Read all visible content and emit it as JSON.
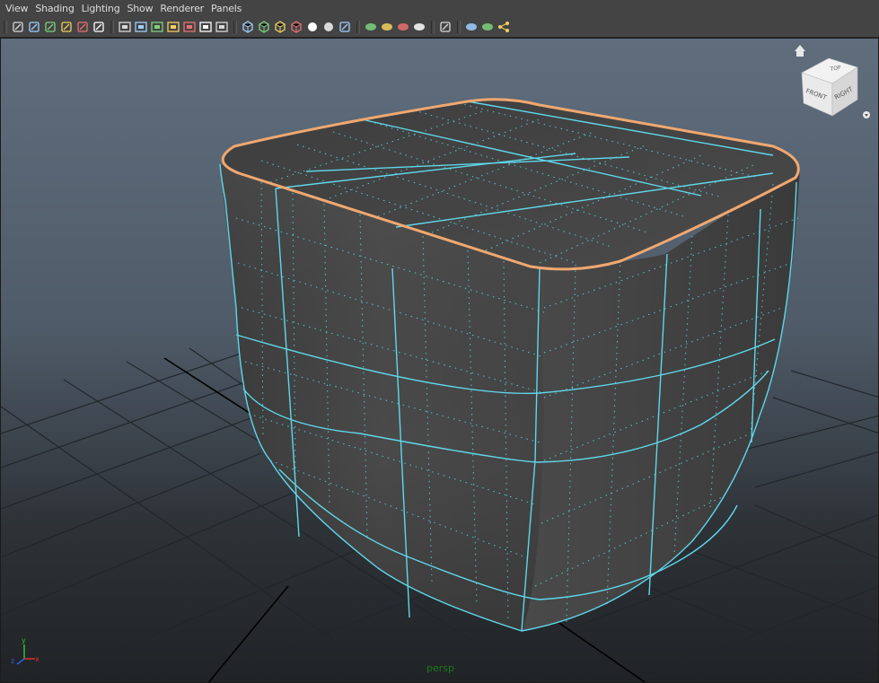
{
  "menu": {
    "items": [
      "View",
      "Shading",
      "Lighting",
      "Show",
      "Renderer",
      "Panels"
    ]
  },
  "toolbar": {
    "groups": [
      [
        "select-camera-icon",
        "camera-attributes-icon",
        "bookmarks-icon",
        "image-plane-icon",
        "2d-pan-zoom-icon",
        "grease-pencil-icon"
      ],
      [
        "grid-icon",
        "film-gate-icon",
        "resolution-gate-icon",
        "gate-mask-icon",
        "field-chart-icon",
        "safe-action-icon",
        "safe-title-icon"
      ],
      [
        "wireframe-icon",
        "smooth-shade-icon",
        "wireframe-on-shaded-icon",
        "textured-icon",
        "use-all-lights-icon",
        "shadows-icon",
        "screen-space-ao-icon"
      ],
      [
        "motion-blur-icon",
        "multisample-aa-icon",
        "depth-of-field-icon",
        "xray-icon"
      ],
      [
        "isolate-select-icon"
      ],
      [
        "xray-joints-icon",
        "xray-active-icon",
        "share-icon"
      ]
    ]
  },
  "viewport": {
    "camera_label": "persp",
    "viewcube": {
      "top_label": "TOP",
      "front_label": "FRONT",
      "right_label": "RIGHT"
    },
    "axis": {
      "y_label": "y",
      "x_label": "x",
      "z_label": "z",
      "x_color": "#d83030",
      "y_color": "#30c030",
      "z_color": "#3060e0"
    },
    "colors": {
      "wire": "#5fd7ea",
      "selected_edge": "#f0a870",
      "grid": "#22262a",
      "axis_line": "#000000"
    }
  }
}
